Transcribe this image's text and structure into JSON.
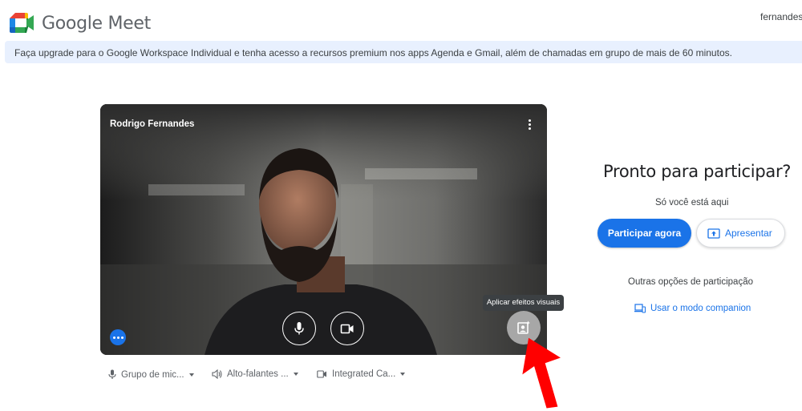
{
  "header": {
    "brand_name": "Google Meet",
    "account_label": "fernandes.r"
  },
  "banner": {
    "text": "Faça upgrade para o Google Workspace Individual e tenha acesso a recursos premium nos apps Agenda e Gmail, além de chamadas em grupo de mais de 60 minutos."
  },
  "preview": {
    "participant_name": "Rodrigo Fernandes",
    "effects_tooltip": "Aplicar efeitos visuais"
  },
  "devices": {
    "microphone": "Grupo de mic...",
    "speaker": "Alto-falantes ...",
    "camera": "Integrated Ca..."
  },
  "join_panel": {
    "title": "Pronto para participar?",
    "status": "Só você está aqui",
    "join_button": "Participar agora",
    "present_button": "Apresentar",
    "other_options": "Outras opções de participação",
    "companion_link": "Usar o modo companion"
  },
  "colors": {
    "accent": "#1a73e8",
    "banner_bg": "#e8f0fe",
    "annotation_arrow": "#ff0000"
  },
  "icons": [
    "meet-logo-icon",
    "more-vert-icon",
    "mic-icon",
    "videocam-icon",
    "visual-effects-icon",
    "more-horiz-icon",
    "speaker-icon",
    "present-icon",
    "companion-icon"
  ]
}
